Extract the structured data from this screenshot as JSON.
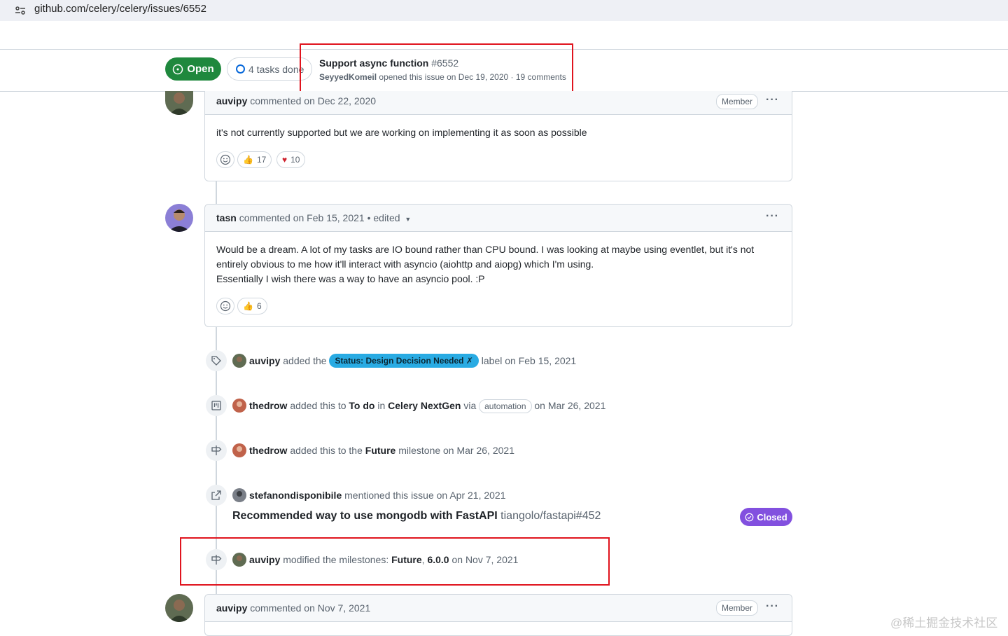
{
  "browser": {
    "url": "github.com/celery/celery/issues/6552"
  },
  "sticky": {
    "status_label": "Open",
    "tasks_label": "4 tasks done",
    "title": "Support async function",
    "number": "#6552",
    "author": "SeyyedKomeil",
    "meta_rest": "opened this issue on Dec 19, 2020 · 19 comments"
  },
  "comments": [
    {
      "author": "auvipy",
      "action": "commented on Dec 22, 2020",
      "badge": "Member",
      "body": [
        "it's not currently supported but we are working on implementing it as soon as possible"
      ],
      "reactions": [
        {
          "icon": "thumbs-up",
          "count": "17"
        },
        {
          "icon": "heart",
          "count": "10"
        }
      ]
    },
    {
      "author": "tasn",
      "action": "commented on Feb 15, 2021 • edited",
      "body": [
        "Would be a dream. A lot of my tasks are IO bound rather than CPU bound. I was looking at maybe using eventlet, but it's not",
        "entirely obvious to me how it'll interact with asyncio (aiohttp and aiopg) which I'm using.",
        "Essentially I wish there was a way to have an asyncio pool. :P"
      ],
      "reactions": [
        {
          "icon": "thumbs-up",
          "count": "6"
        }
      ]
    },
    {
      "author": "auvipy",
      "action": "commented on Nov 7, 2021",
      "badge": "Member"
    }
  ],
  "events": {
    "label": {
      "actor": "auvipy",
      "pre": "added the",
      "label": "Status: Design Decision Needed",
      "label_x": "✗",
      "post": "label on Feb 15, 2021",
      "label_color": "#29abe3"
    },
    "project": {
      "actor": "thedrow",
      "pre": "added this to",
      "column": "To do",
      "in": "in",
      "project": "Celery NextGen",
      "via": "via",
      "via_pill": "automation",
      "post": "on Mar 26, 2021"
    },
    "milestone": {
      "actor": "thedrow",
      "pre": "added this to the",
      "milestone": "Future",
      "post": "milestone on Mar 26, 2021"
    },
    "mention": {
      "actor": "stefanondisponibile",
      "post": "mentioned this issue on Apr 21, 2021",
      "ref_title": "Recommended way to use mongodb with FastAPI",
      "ref_id": "tiangolo/fastapi#452",
      "ref_state": "Closed"
    },
    "modified": {
      "actor": "auvipy",
      "pre": "modified the milestones:",
      "m1": "Future",
      "sep": ",",
      "m2": "6.0.0",
      "post": "on Nov 7, 2021"
    }
  },
  "watermark": "@稀土掘金技术社区",
  "colors": {
    "open": "#1f883d",
    "closed": "#8250df",
    "highlight": "#e0141e"
  }
}
